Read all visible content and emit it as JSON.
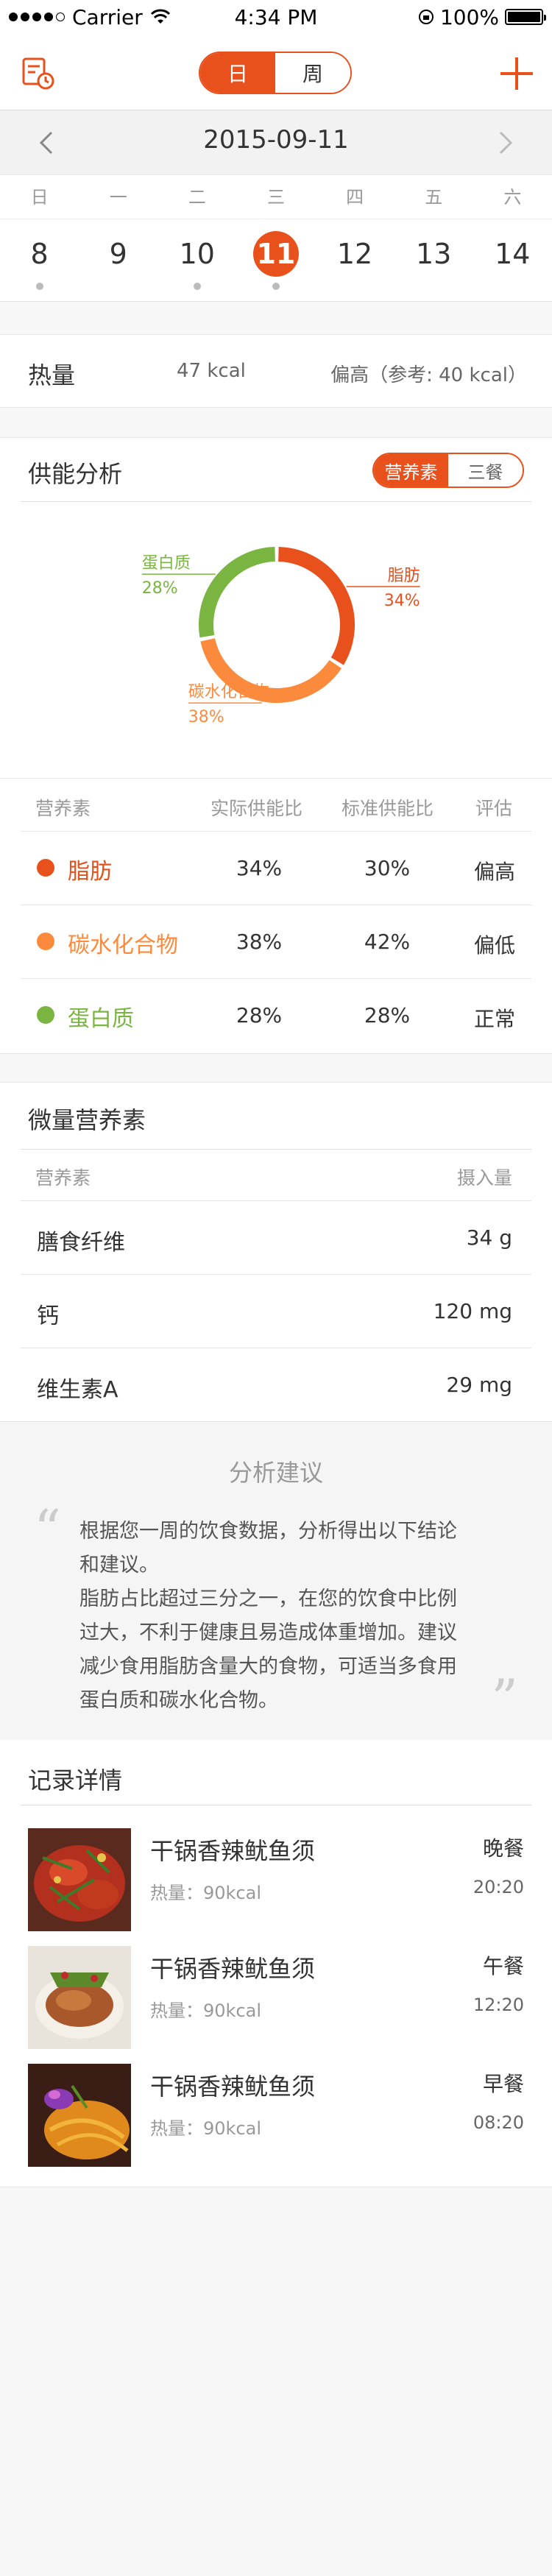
{
  "status_bar": {
    "carrier": "Carrier",
    "time": "4:34 PM",
    "battery": "100%"
  },
  "nav": {
    "tab_day": "日",
    "tab_week": "周",
    "left_icon": "calendar-report-icon",
    "right_icon": "plus-icon"
  },
  "date_bar": {
    "date": "2015-09-11"
  },
  "week": {
    "headers": [
      "日",
      "一",
      "二",
      "三",
      "四",
      "五",
      "六"
    ],
    "days": [
      "8",
      "9",
      "10",
      "11",
      "12",
      "13",
      "14"
    ],
    "selected_index": 3,
    "marked": [
      0,
      2,
      3
    ]
  },
  "heat": {
    "label": "热量",
    "value": "47 kcal",
    "note": "偏高（参考: 40 kcal）"
  },
  "supply": {
    "title": "供能分析",
    "tab_nutrients": "营养素",
    "tab_meals": "三餐",
    "table_headers": {
      "nutrient": "营养素",
      "actual": "实际供能比",
      "standard": "标准供能比",
      "evaluation": "评估"
    },
    "rows": [
      {
        "name": "脂肪",
        "actual": "34%",
        "standard": "30%",
        "evaluation": "偏高",
        "color": "#e8501c"
      },
      {
        "name": "碳水化合物",
        "actual": "38%",
        "standard": "42%",
        "evaluation": "偏低",
        "color": "#fc8a3c"
      },
      {
        "name": "蛋白质",
        "actual": "28%",
        "standard": "28%",
        "evaluation": "正常",
        "color": "#7ab542"
      }
    ]
  },
  "chart_data": {
    "type": "pie",
    "donut": true,
    "categories": [
      "脂肪",
      "碳水化合物",
      "蛋白质"
    ],
    "values": [
      34,
      38,
      28
    ],
    "value_labels": [
      "34%",
      "38%",
      "28%"
    ],
    "colors": [
      "#e8501c",
      "#fc8a3c",
      "#7ab542"
    ]
  },
  "micro": {
    "title": "微量营养素",
    "header_nutrient": "营养素",
    "header_amount": "摄入量",
    "rows": [
      {
        "name": "膳食纤维",
        "amount": "34 g"
      },
      {
        "name": "钙",
        "amount": "120 mg"
      },
      {
        "name": "维生素A",
        "amount": "29 mg"
      }
    ]
  },
  "advice": {
    "title": "分析建议",
    "lines": [
      "根据您一周的饮食数据，分析得出以下结论",
      "和建议。",
      "脂肪占比超过三分之一，在您的饮食中比例",
      "过大，不利于健康且易造成体重增加。建议",
      "减少食用脂肪含量大的食物，可适当多食用",
      "蛋白质和碳水化合物。"
    ]
  },
  "records": {
    "title": "记录详情",
    "items": [
      {
        "name": "干锅香辣鱿鱼须",
        "heat": "热量：90kcal",
        "meal": "晚餐",
        "time": "20:20"
      },
      {
        "name": "干锅香辣鱿鱼须",
        "heat": "热量：90kcal",
        "meal": "午餐",
        "time": "12:20"
      },
      {
        "name": "干锅香辣鱿鱼须",
        "heat": "热量：90kcal",
        "meal": "早餐",
        "time": "08:20"
      }
    ]
  }
}
